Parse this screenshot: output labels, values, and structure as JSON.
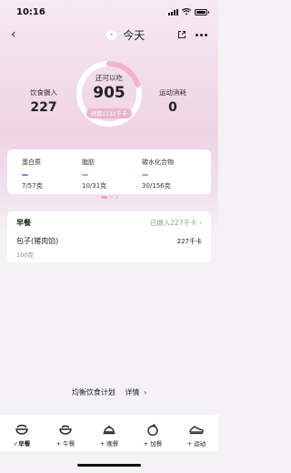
{
  "status_bar": {
    "time": "10:16"
  },
  "nav": {
    "title": "今天",
    "prev_icon": "chevron-left-icon",
    "back_icon": "back-arrow-icon",
    "share_icon": "share-icon",
    "more_icon": "more-icon"
  },
  "summary": {
    "intake_label": "饮食摄入",
    "intake_value": "227",
    "remaining_label": "还可以吃",
    "remaining_value": "905",
    "budget_pill": "预算1132千卡",
    "remaining_progress": 0.2,
    "burn_label": "运动消耗",
    "burn_value": "0"
  },
  "macros": [
    {
      "name": "蛋白质",
      "value": "7/57克",
      "color": "#8f7df0"
    },
    {
      "name": "脂肪",
      "value": "10/31克",
      "color": "#ee8fc0"
    },
    {
      "name": "碳水化合物",
      "value": "30/156克",
      "color": "#7db7f5"
    }
  ],
  "pager": {
    "count": 3,
    "active": 0
  },
  "meal": {
    "title": "早餐",
    "status": "已摄入227千卡",
    "items": [
      {
        "name": "包子(猪肉馅)",
        "kcal": "227千卡",
        "weight": "100克"
      }
    ]
  },
  "plan": {
    "label": "均衡饮食计划",
    "link": "详情"
  },
  "tabs": [
    {
      "label": "早餐",
      "prefix": "check",
      "icon": "breakfast-icon",
      "active": true
    },
    {
      "label": "+ 午餐",
      "icon": "lunch-icon"
    },
    {
      "label": "+ 晚餐",
      "icon": "dinner-icon"
    },
    {
      "label": "+ 加餐",
      "icon": "snack-icon"
    },
    {
      "label": "+ 运动",
      "icon": "exercise-icon"
    }
  ],
  "colors": {
    "accent": "#e7a2c6",
    "ring_track": "#ffffff",
    "ring_progress": "#f1b3d1"
  }
}
